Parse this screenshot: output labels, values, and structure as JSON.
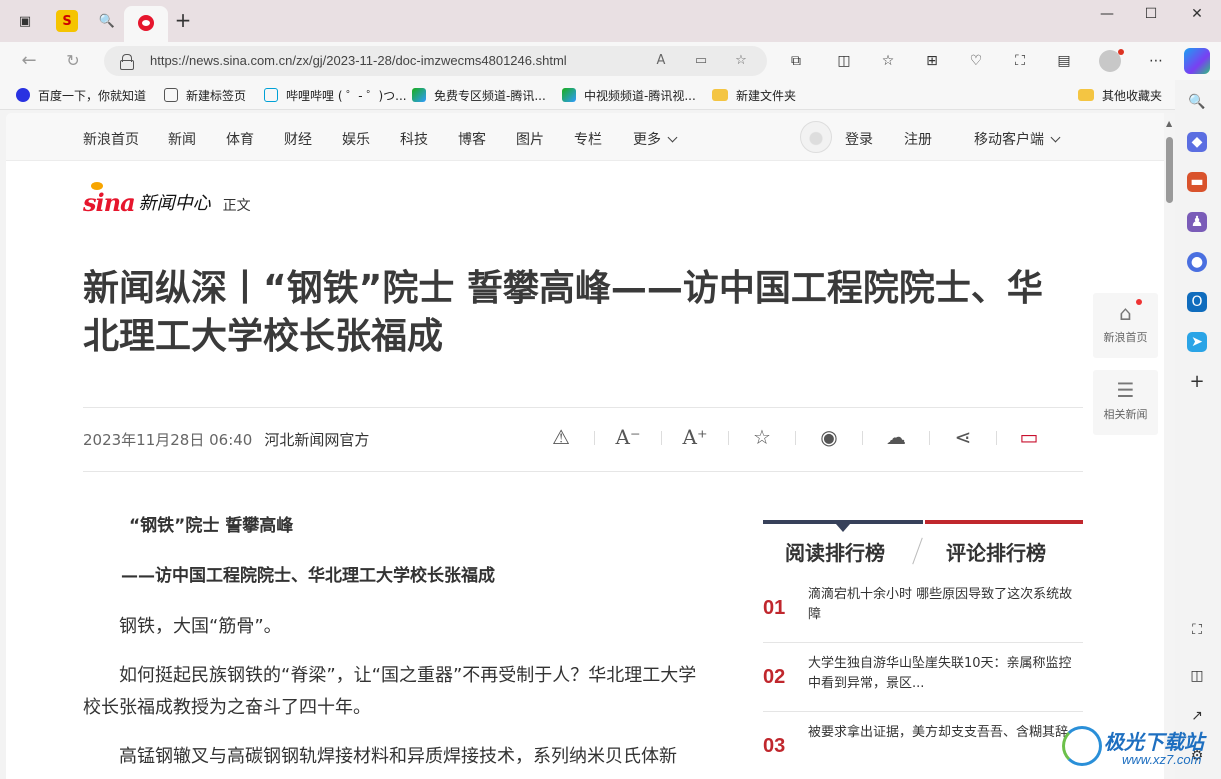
{
  "browser": {
    "url": "https://news.sina.com.cn/zx/gj/2023-11-28/doc-imzwecms4801246.shtml",
    "window_controls": {
      "minimize": "—",
      "maximize": "☐",
      "close": "✕"
    }
  },
  "favorites": [
    {
      "label": "百度一下，你就知道",
      "icon": "baidu-paw-icon",
      "color": "#2932e1"
    },
    {
      "label": "新建标签页",
      "icon": "newtab-icon",
      "color": "#555555"
    },
    {
      "label": "哔哩哔哩 ( ゜- ゜)つ...",
      "icon": "bilibili-icon",
      "color": "#00a1d6"
    },
    {
      "label": "免费专区频道-腾讯...",
      "icon": "tencent-video-icon",
      "color": "#1aad19"
    },
    {
      "label": "中视频频道-腾讯视...",
      "icon": "tencent-video-icon",
      "color": "#1aad19"
    },
    {
      "label": "新建文件夹",
      "icon": "folder-icon",
      "color": "#f4c542"
    }
  ],
  "other_favorites": "其他收藏夹",
  "sina_nav": {
    "items": [
      "新浪首页",
      "新闻",
      "体育",
      "财经",
      "娱乐",
      "科技",
      "博客",
      "图片",
      "专栏",
      "更多"
    ],
    "login": "登录",
    "register": "注册",
    "mobile": "移动客户端"
  },
  "logo": {
    "brand": "sina",
    "channel": "新闻中心",
    "section": "正文"
  },
  "article": {
    "headline": "新闻纵深丨“钢铁”院士 誓攀高峰——访中国工程院院士、华北理工大学校长张福成",
    "date": "2023年11月28日 06:40",
    "source": "河北新闻网官方",
    "paragraphs": [
      "“钢铁”院士 誓攀高峰",
      "——访中国工程院院士、华北理工大学校长张福成",
      "钢铁，大国“筋骨”。",
      "如何挺起民族钢铁的“脊梁”，让“国之重器”不再受制于人？华北理工大学校长张福成教授为之奋斗了四十年。",
      "高锰钢辙叉与高碳钢钢轨焊接材料和异质焊接技术，系列纳米贝氏体新"
    ]
  },
  "float_buttons": {
    "home": "新浪首页",
    "related": "相关新闻"
  },
  "ranking": {
    "tabs": [
      "阅读排行榜",
      "评论排行榜"
    ],
    "items": [
      {
        "num": "01",
        "title": "滴滴宕机十余小时 哪些原因导致了这次系统故障"
      },
      {
        "num": "02",
        "title": "大学生独自游华山坠崖失联10天：亲属称监控中看到异常，景区..."
      },
      {
        "num": "03",
        "title": "被要求拿出证据，美方却支支吾吾、含糊其辞"
      }
    ]
  },
  "watermark": {
    "line1": "极光下载站",
    "line2": "www.xz7.com"
  },
  "colors": {
    "sina_red": "#e6162d",
    "rank_red": "#c0272d",
    "rank_navy": "#37415a"
  }
}
